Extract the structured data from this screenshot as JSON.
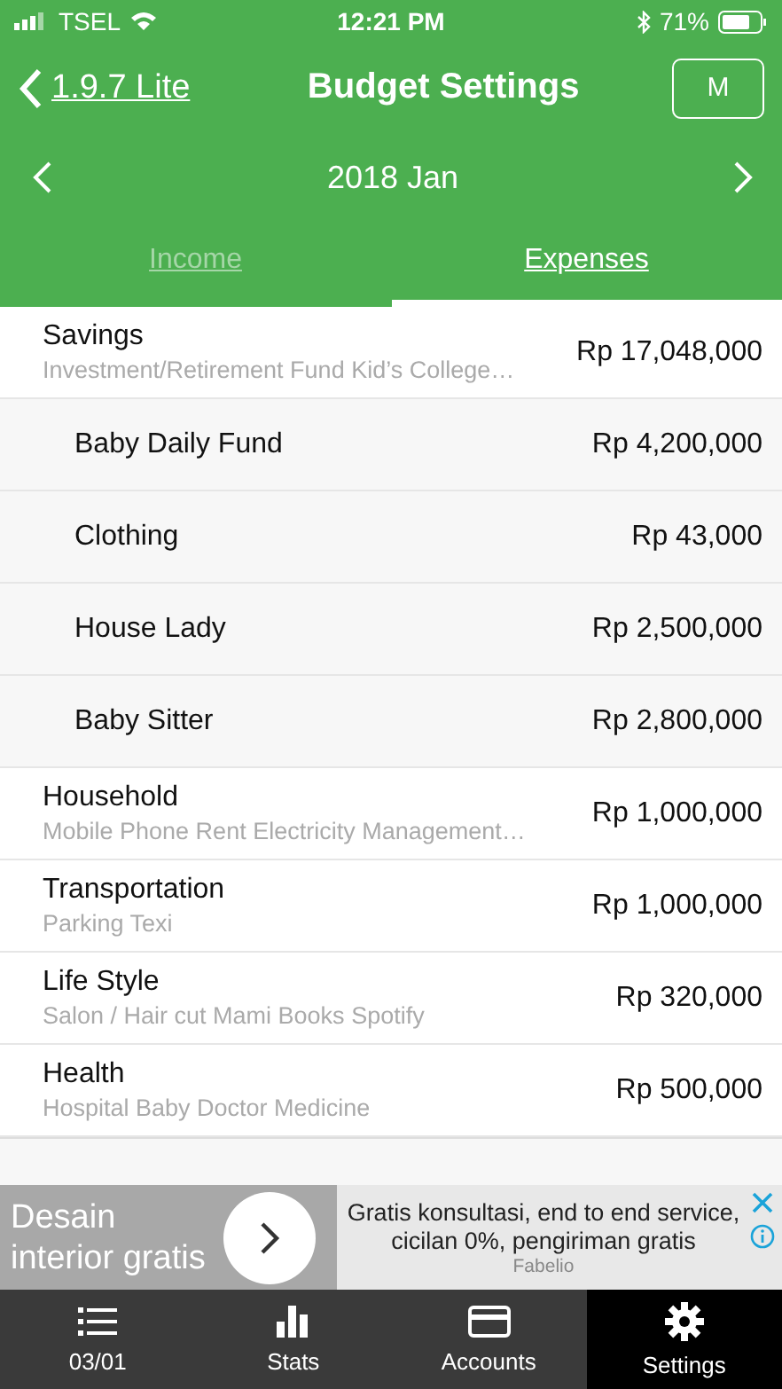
{
  "status_bar": {
    "carrier": "TSEL",
    "time": "12:21 PM",
    "battery": "71%"
  },
  "nav": {
    "back": "1.9.7 Lite",
    "title": "Budget Settings",
    "action": "M"
  },
  "period": {
    "label": "2018 Jan"
  },
  "tabs": [
    {
      "label": "Income",
      "selected": false
    },
    {
      "label": "Expenses",
      "selected": true
    }
  ],
  "categories": [
    {
      "name": "Savings",
      "note": "Investment/Retirement Fund Kid’s College…",
      "amount": "Rp 17,048,000",
      "children": [
        {
          "name": "Baby Daily Fund",
          "amount": "Rp 4,200,000"
        },
        {
          "name": "Clothing",
          "amount": "Rp 43,000"
        },
        {
          "name": "House Lady",
          "amount": "Rp 2,500,000"
        },
        {
          "name": "Baby Sitter",
          "amount": "Rp 2,800,000"
        }
      ]
    },
    {
      "name": "Household",
      "note": "Mobile Phone Rent Electricity Management…",
      "amount": "Rp 1,000,000"
    },
    {
      "name": "Transportation",
      "note": "Parking Texi",
      "amount": "Rp 1,000,000"
    },
    {
      "name": "Life Style",
      "note": "Salon / Hair cut Mami Books Spotify",
      "amount": "Rp 320,000"
    },
    {
      "name": "Health",
      "note": "Hospital Baby Doctor Medicine",
      "amount": "Rp 500,000"
    }
  ],
  "ad": {
    "headline": "Desain interior gratis",
    "body": "Gratis konsultasi, end to end service, cicilan 0%, pengiriman gratis",
    "advertiser": "Fabelio"
  },
  "tab_bar": [
    {
      "kind": "list",
      "label": "03/01",
      "selected": false
    },
    {
      "kind": "stats",
      "label": "Stats",
      "selected": false
    },
    {
      "kind": "card",
      "label": "Accounts",
      "selected": false
    },
    {
      "kind": "gear",
      "label": "Settings",
      "selected": true
    }
  ]
}
